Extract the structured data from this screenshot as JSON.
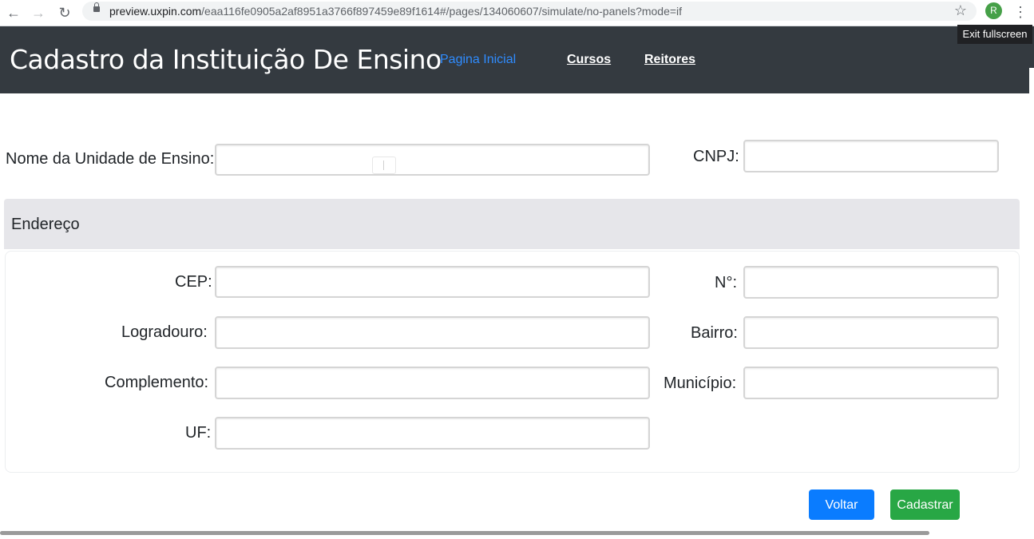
{
  "browser": {
    "url_host": "preview.uxpin.com",
    "url_path": "/eaa116fe0905a2af8951a3766f897459e89f1614#/pages/134060607/simulate/no-panels?mode=if",
    "profile_initial": "R",
    "exit_fullscreen": "Exit fullscreen",
    "icons": [
      "back-icon",
      "forward-icon",
      "reload-icon",
      "lock-icon",
      "star-icon",
      "kebab-menu-icon"
    ]
  },
  "header": {
    "title": "Cadastro da Instituição De Ensino",
    "nav": [
      {
        "label": "Pagina Inicial",
        "active": true
      },
      {
        "label": "Cursos",
        "active": false
      },
      {
        "label": "Reitores",
        "active": false
      }
    ]
  },
  "form": {
    "nome_label": "Nome da Unidade de Ensino:",
    "nome_value": "",
    "cnpj_label": "CNPJ:",
    "cnpj_value": "",
    "endereco": {
      "title": "Endereço",
      "cep_label": "CEP:",
      "cep_value": "",
      "numero_label": "N°:",
      "numero_value": "",
      "logradouro_label": "Logradouro:",
      "logradouro_value": "",
      "bairro_label": "Bairro:",
      "bairro_value": "",
      "complemento_label": "Complemento:",
      "complemento_value": "",
      "municipio_label": "Município:",
      "municipio_value": "",
      "uf_label": "UF:",
      "uf_value": ""
    }
  },
  "actions": {
    "voltar": "Voltar",
    "cadastrar": "Cadastrar"
  },
  "colors": {
    "header_bg": "#343a40",
    "active_nav": "#2f8cff",
    "primary": "#0a7cff",
    "success": "#28a745",
    "section_bg": "#e6e6ea"
  }
}
